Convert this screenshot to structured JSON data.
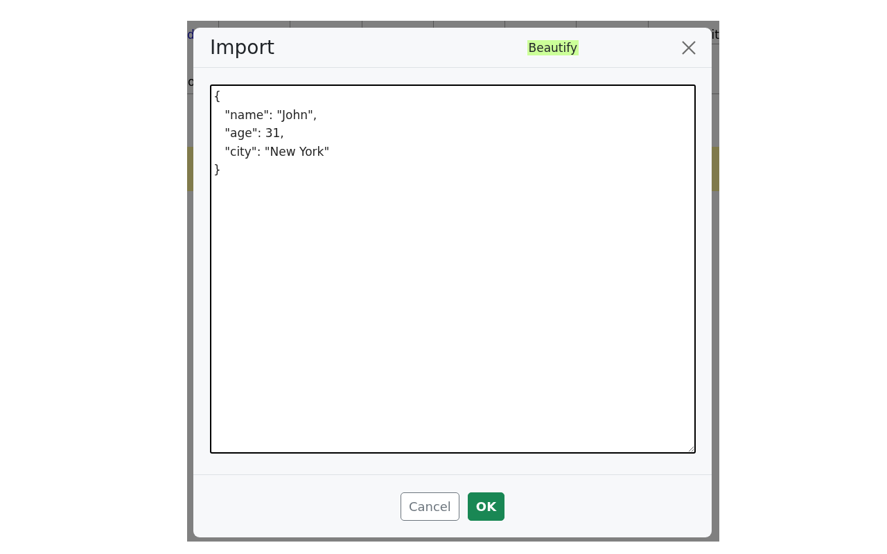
{
  "background": {
    "left_fragments": [
      "d",
      "o"
    ],
    "right_fragments": [
      "it"
    ]
  },
  "dialog": {
    "title": "Import",
    "beautify_button": "Beautify",
    "editor": {
      "value": "{\n   \"name\": \"John\",\n   \"age\": 31,\n   \"city\": \"New York\"\n}"
    },
    "buttons": [
      {
        "kind": "secondary",
        "label": "Cancel"
      },
      {
        "kind": "primary",
        "label": "OK"
      }
    ]
  }
}
